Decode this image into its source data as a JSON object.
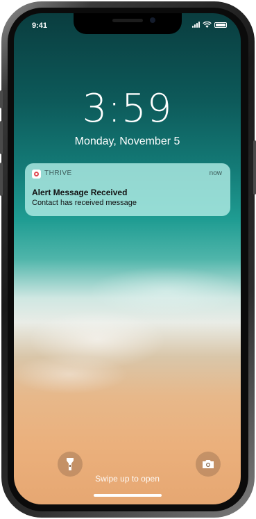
{
  "status_bar": {
    "time": "9:41"
  },
  "lock_screen": {
    "time": "3:59",
    "date": "Monday, November 5"
  },
  "notification": {
    "app_name": "THRIVE",
    "time": "now",
    "title": "Alert Message Received",
    "body": "Contact has received message"
  },
  "bottom": {
    "flashlight_icon": "flashlight-icon",
    "camera_icon": "camera-icon",
    "swipe_hint": "Swipe up to open"
  },
  "colors": {
    "notification_bg": "#b0ece4",
    "app_icon_ring": "#e04a52"
  }
}
